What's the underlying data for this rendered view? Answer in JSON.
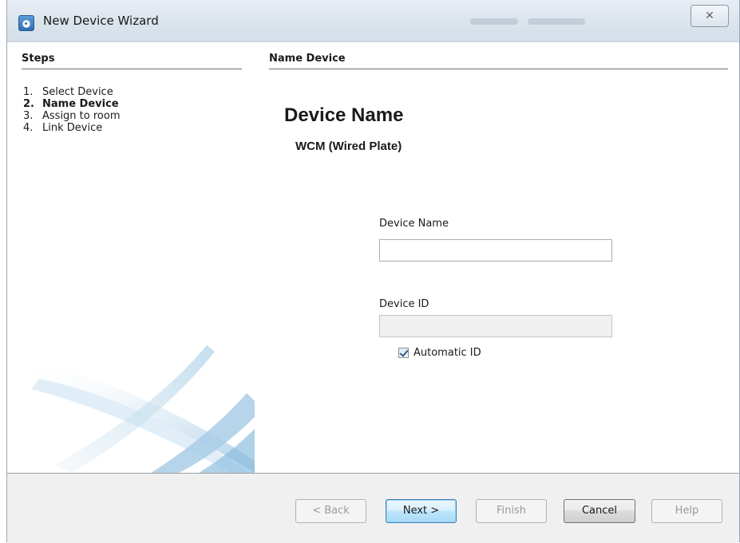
{
  "window": {
    "title": "New Device Wizard",
    "close_glyph": "✕"
  },
  "steps": {
    "title": "Steps",
    "items": [
      {
        "num": "1.",
        "label": "Select Device",
        "current": false
      },
      {
        "num": "2.",
        "label": "Name Device",
        "current": true
      },
      {
        "num": "3.",
        "label": "Assign to room",
        "current": false
      },
      {
        "num": "4.",
        "label": "Link Device",
        "current": false
      }
    ]
  },
  "main": {
    "heading": "Name Device",
    "big_title": "Device Name",
    "subtitle": "WCM (Wired Plate)",
    "device_name": {
      "label": "Device Name",
      "value": ""
    },
    "device_id": {
      "label": "Device ID",
      "value": "",
      "disabled": true
    },
    "automatic_id": {
      "label": "Automatic ID",
      "checked": true
    }
  },
  "buttons": {
    "back": "< Back",
    "next": "Next >",
    "finish": "Finish",
    "cancel": "Cancel",
    "help": "Help"
  },
  "colors": {
    "titlebar": "#dde5ee",
    "button_bar": "#f0f0f0",
    "default_button": "#bee6fd",
    "swoosh": "#a9cde6"
  },
  "icons": {
    "app": "wizard-app-icon",
    "close": "close-icon",
    "checkbox": "checkmark-icon"
  }
}
